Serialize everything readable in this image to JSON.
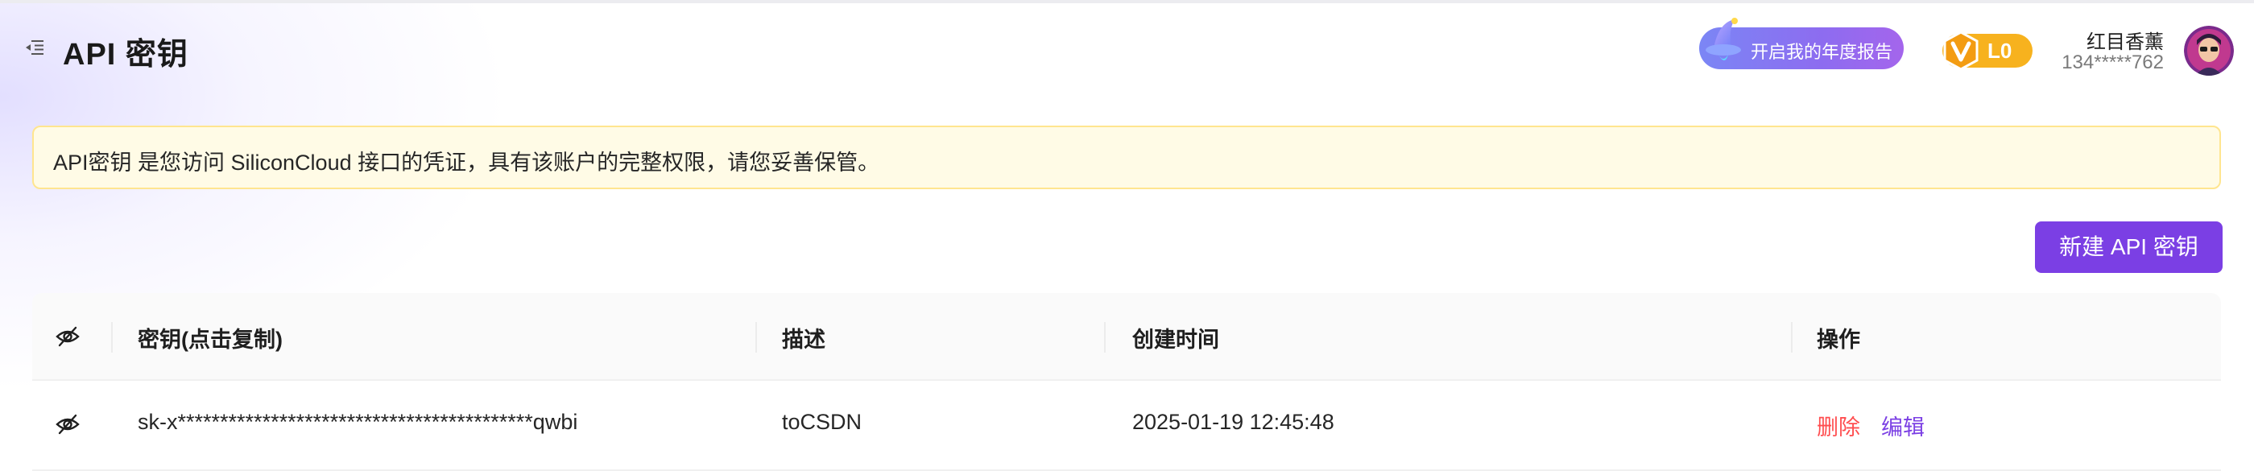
{
  "header": {
    "title": "API 密钥",
    "annual_report_label": "开启我的年度报告",
    "level": "L0",
    "user": {
      "name": "红目香薰",
      "phone": "134*****762"
    }
  },
  "notice": {
    "text": "API密钥 是您访问 SiliconCloud 接口的凭证，具有该账户的完整权限，请您妥善保管。"
  },
  "actions": {
    "new_key_label": "新建 API 密钥"
  },
  "table": {
    "columns": {
      "key": "密钥(点击复制)",
      "description": "描述",
      "created_at": "创建时间",
      "operations": "操作"
    },
    "rows": [
      {
        "key": "sk-x******************************************qwbi",
        "description": "toCSDN",
        "created_at": "2025-01-19 12:45:48",
        "delete_label": "删除",
        "edit_label": "编辑"
      }
    ]
  },
  "icons": {
    "menu_toggle": "menu-fold-icon",
    "visibility": "eye-slash-icon",
    "level": "v-badge-icon"
  },
  "colors": {
    "primary": "#7b3fe4",
    "danger": "#ff4d4f",
    "notice_bg": "#fffbe6",
    "notice_border": "#ffe58f",
    "level_badge": "#f7b21e"
  }
}
